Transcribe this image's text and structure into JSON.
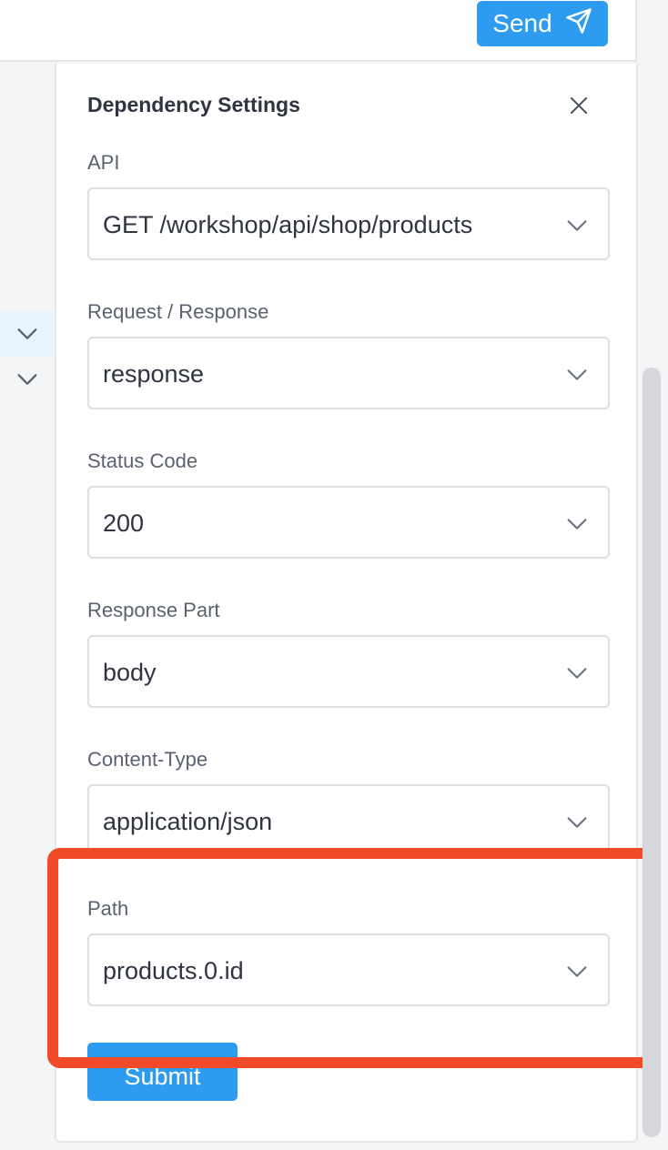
{
  "header": {
    "send_label": "Send"
  },
  "panel": {
    "title": "Dependency Settings",
    "fields": [
      {
        "label": "API",
        "value": "GET /workshop/api/shop/products"
      },
      {
        "label": "Request / Response",
        "value": "response"
      },
      {
        "label": "Status Code",
        "value": "200"
      },
      {
        "label": "Response Part",
        "value": "body"
      },
      {
        "label": "Content-Type",
        "value": "application/json"
      },
      {
        "label": "Path",
        "value": "products.0.id"
      }
    ],
    "submit_label": "Submit"
  },
  "colors": {
    "primary": "#2d9cf0",
    "highlight": "#f04a28"
  }
}
